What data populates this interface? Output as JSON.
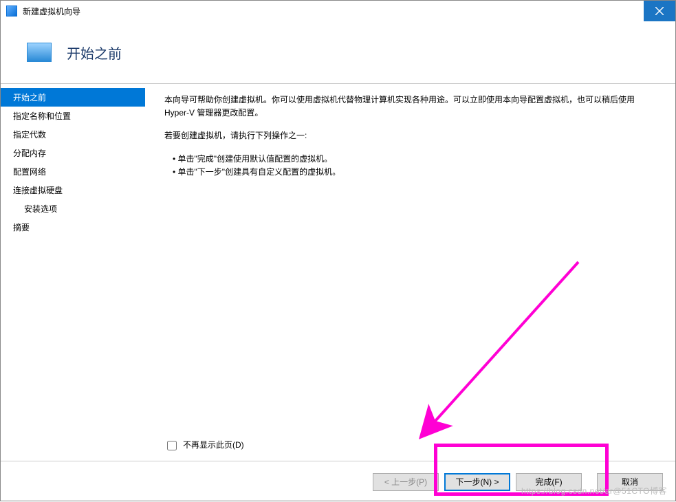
{
  "titlebar": {
    "title": "新建虚拟机向导"
  },
  "header": {
    "heading": "开始之前"
  },
  "sidebar": {
    "items": [
      {
        "label": "开始之前",
        "selected": true
      },
      {
        "label": "指定名称和位置"
      },
      {
        "label": "指定代数"
      },
      {
        "label": "分配内存"
      },
      {
        "label": "配置网络"
      },
      {
        "label": "连接虚拟硬盘"
      },
      {
        "label": "安装选项",
        "indent": true
      },
      {
        "label": "摘要"
      }
    ]
  },
  "content": {
    "paragraph1": "本向导可帮助你创建虚拟机。你可以使用虚拟机代替物理计算机实现各种用途。可以立即使用本向导配置虚拟机，也可以稍后使用 Hyper-V 管理器更改配置。",
    "paragraph2": "若要创建虚拟机，请执行下列操作之一:",
    "bullet1": "单击\"完成\"创建使用默认值配置的虚拟机。",
    "bullet2": "单击\"下一步\"创建具有自定义配置的虚拟机。",
    "checkbox_label": "不再显示此页(D)"
  },
  "footer": {
    "prev": "< 上一步(P)",
    "next": "下一步(N) >",
    "finish": "完成(F)",
    "cancel": "取消"
  },
  "watermark": "https://blog.csdn.net/ar@51CTO博客"
}
